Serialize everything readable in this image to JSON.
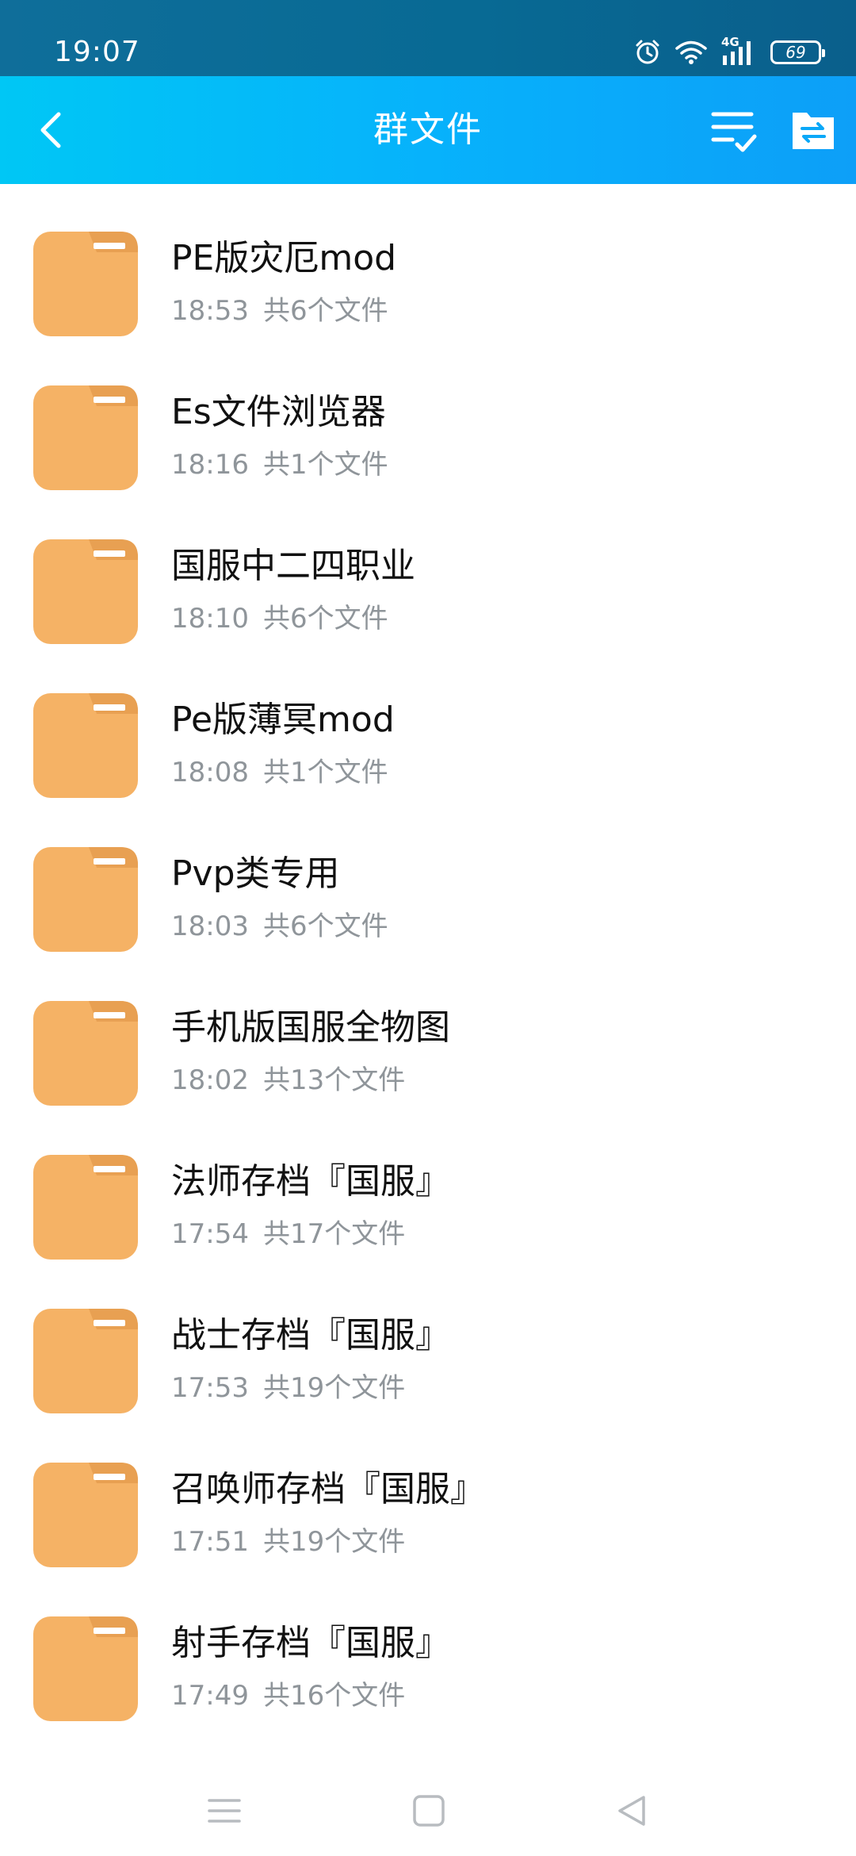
{
  "status_bar": {
    "time": "19:07",
    "network": "4G",
    "battery": "69",
    "icons": [
      "alarm-icon",
      "wifi-icon",
      "signal-icon",
      "battery-icon"
    ]
  },
  "header": {
    "title": "群文件",
    "back_icon": "chevron-left-icon",
    "actions": [
      "sort-check-icon",
      "folder-transfer-icon"
    ]
  },
  "files": [
    {
      "name": "PE版灾厄mod",
      "time": "18:53",
      "count": "共6个文件"
    },
    {
      "name": "Es文件浏览器",
      "time": "18:16",
      "count": "共1个文件"
    },
    {
      "name": "国服中二四职业",
      "time": "18:10",
      "count": "共6个文件"
    },
    {
      "name": "Pe版薄冥mod",
      "time": "18:08",
      "count": "共1个文件"
    },
    {
      "name": "Pvp类专用",
      "time": "18:03",
      "count": "共6个文件"
    },
    {
      "name": "手机版国服全物图",
      "time": "18:02",
      "count": "共13个文件"
    },
    {
      "name": "法师存档『国服』",
      "time": "17:54",
      "count": "共17个文件"
    },
    {
      "name": "战士存档『国服』",
      "time": "17:53",
      "count": "共19个文件"
    },
    {
      "name": "召唤师存档『国服』",
      "time": "17:51",
      "count": "共19个文件"
    },
    {
      "name": "射手存档『国服』",
      "time": "17:49",
      "count": "共16个文件"
    }
  ],
  "colors": {
    "header_gradient_start": "#00c7f5",
    "header_gradient_end": "#0d9ff8",
    "folder": "#f5b265",
    "folder_tab": "#e8a052",
    "meta_text": "#8f959a"
  },
  "system_nav": [
    "menu-icon",
    "home-icon",
    "back-triangle-icon"
  ]
}
